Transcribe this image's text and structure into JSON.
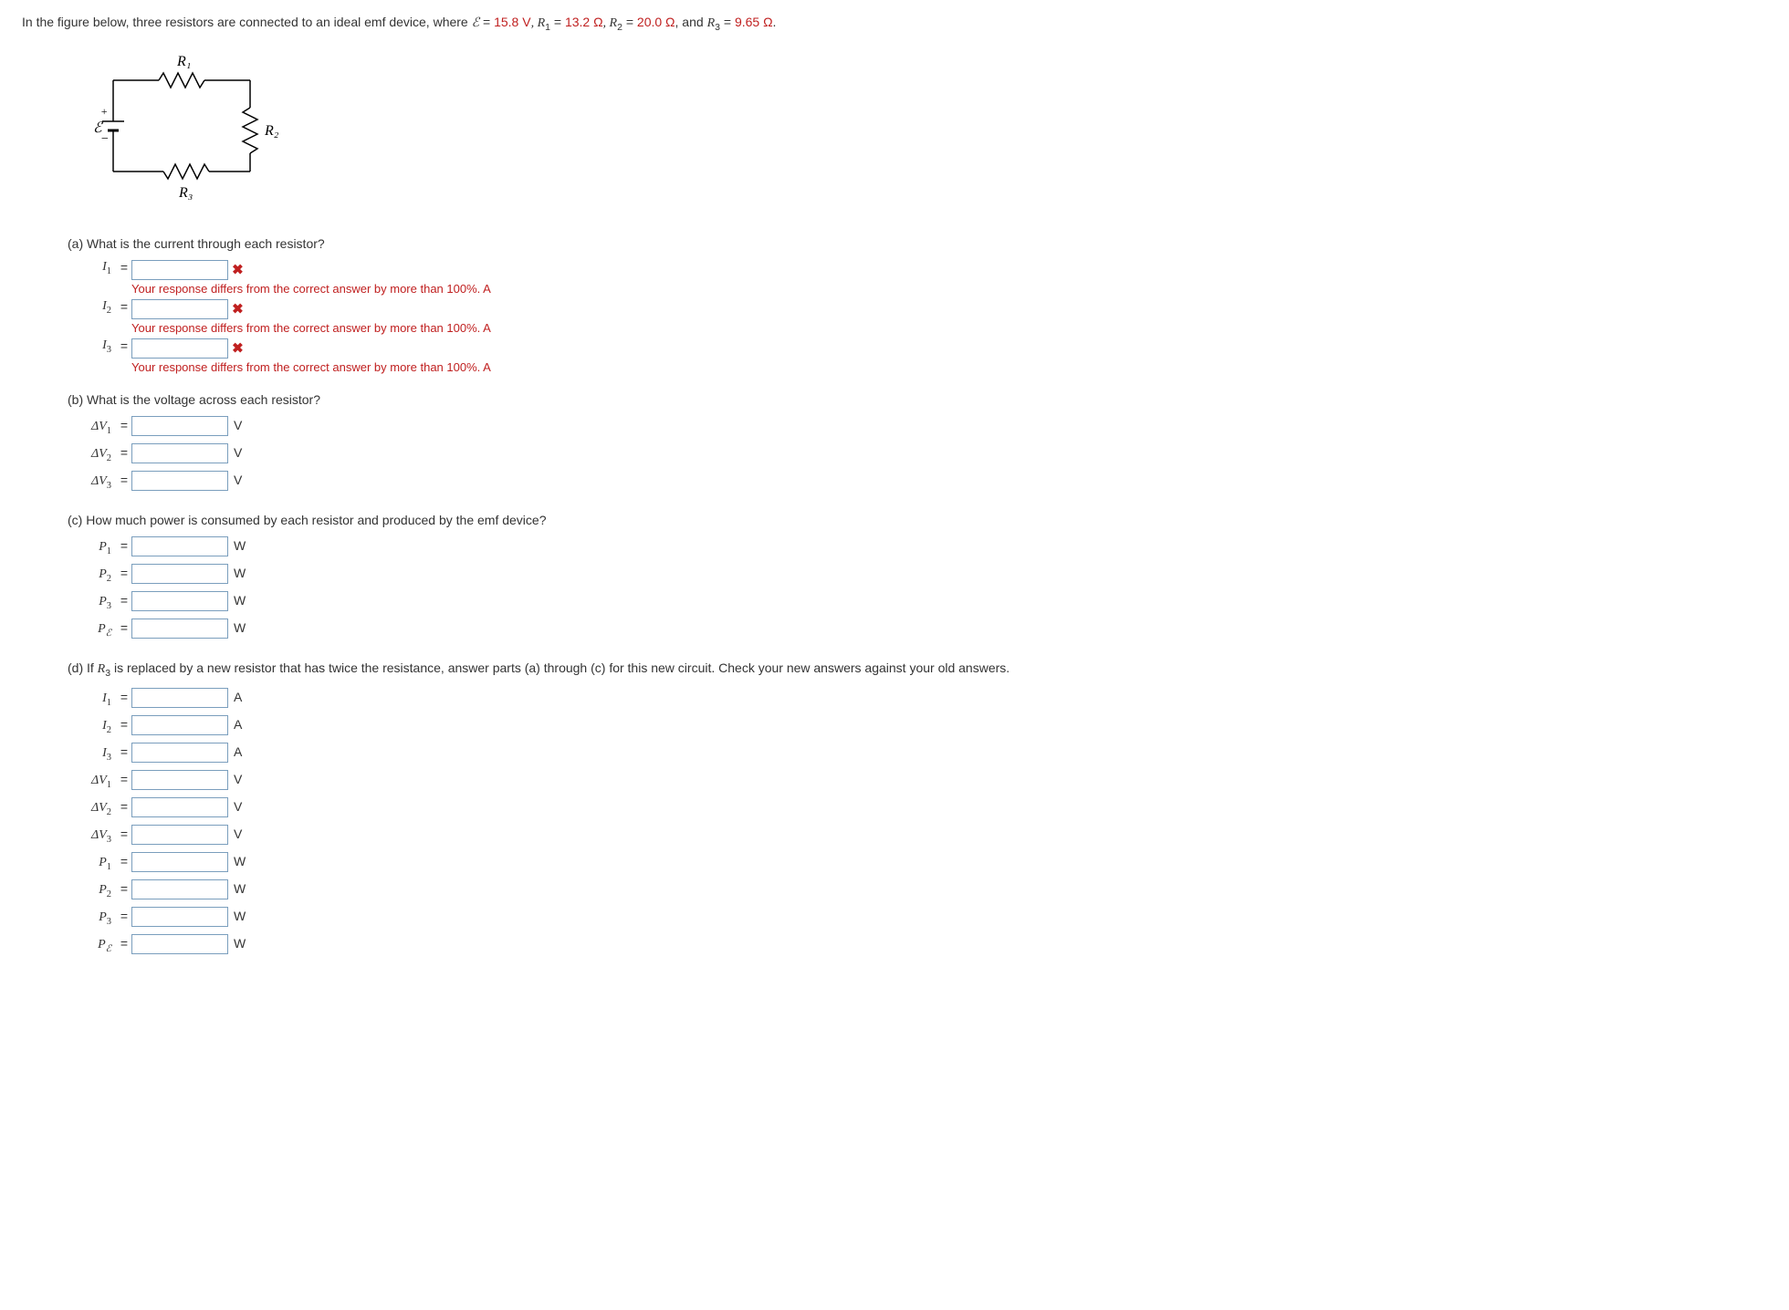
{
  "problem": {
    "intro": "In the figure below, three resistors are connected to an ideal emf device, where ",
    "emf_var": "ℰ",
    "emf_eq": " = ",
    "emf_val": "15.8 V",
    "r1_lbl": ",   R",
    "r1_sub": "1",
    "r1_eq": " = ",
    "r1_val": "13.2 Ω",
    "r2_lbl": ",   R",
    "r2_sub": "2",
    "r2_eq": " = ",
    "r2_val": "20.0 Ω",
    "and": ",  and ",
    "r3_lbl": "R",
    "r3_sub": "3",
    "r3_eq": " = ",
    "r3_val": "9.65 Ω",
    "end": "."
  },
  "figure": {
    "R1": "R₁",
    "R2": "R₂",
    "R3": "R₃",
    "E": "ℰ",
    "plus": "+",
    "minus": "−"
  },
  "part_a": {
    "heading": "(a) What is the current through each resistor?",
    "rows": [
      {
        "label_base": "I",
        "label_sub": "1",
        "unit": "",
        "has_x": true,
        "feedback": "Your response differs from the correct answer by more than 100%. A"
      },
      {
        "label_base": "I",
        "label_sub": "2",
        "unit": "",
        "has_x": true,
        "feedback": "Your response differs from the correct answer by more than 100%. A"
      },
      {
        "label_base": "I",
        "label_sub": "3",
        "unit": "",
        "has_x": true,
        "feedback": "Your response differs from the correct answer by more than 100%. A"
      }
    ]
  },
  "part_b": {
    "heading": "(b) What is the voltage across each resistor?",
    "rows": [
      {
        "label_pre": "Δ",
        "label_base": "V",
        "label_sub": "1",
        "unit": "V"
      },
      {
        "label_pre": "Δ",
        "label_base": "V",
        "label_sub": "2",
        "unit": "V"
      },
      {
        "label_pre": "Δ",
        "label_base": "V",
        "label_sub": "3",
        "unit": "V"
      }
    ]
  },
  "part_c": {
    "heading": "(c) How much power is consumed by each resistor and produced by the emf device?",
    "rows": [
      {
        "label_base": "P",
        "label_sub": "1",
        "unit": "W"
      },
      {
        "label_base": "P",
        "label_sub": "2",
        "unit": "W"
      },
      {
        "label_base": "P",
        "label_sub": "3",
        "unit": "W"
      },
      {
        "label_base": "P",
        "label_sub": "ℰ",
        "sub_italic": true,
        "unit": "W"
      }
    ]
  },
  "part_d": {
    "heading_pre": "(d) If ",
    "heading_var": "R",
    "heading_sub": "3",
    "heading_post": " is replaced by a new resistor that has twice the resistance, answer parts (a) through (c) for this new circuit. Check your new answers against your old answers.",
    "rows": [
      {
        "label_base": "I",
        "label_sub": "1",
        "unit": "A"
      },
      {
        "label_base": "I",
        "label_sub": "2",
        "unit": "A"
      },
      {
        "label_base": "I",
        "label_sub": "3",
        "unit": "A"
      },
      {
        "label_pre": "Δ",
        "label_base": "V",
        "label_sub": "1",
        "unit": "V"
      },
      {
        "label_pre": "Δ",
        "label_base": "V",
        "label_sub": "2",
        "unit": "V"
      },
      {
        "label_pre": "Δ",
        "label_base": "V",
        "label_sub": "3",
        "unit": "V"
      },
      {
        "label_base": "P",
        "label_sub": "1",
        "unit": "W"
      },
      {
        "label_base": "P",
        "label_sub": "2",
        "unit": "W"
      },
      {
        "label_base": "P",
        "label_sub": "3",
        "unit": "W"
      },
      {
        "label_base": "P",
        "label_sub": "ℰ",
        "sub_italic": true,
        "unit": "W"
      }
    ]
  },
  "eq_sign": "="
}
